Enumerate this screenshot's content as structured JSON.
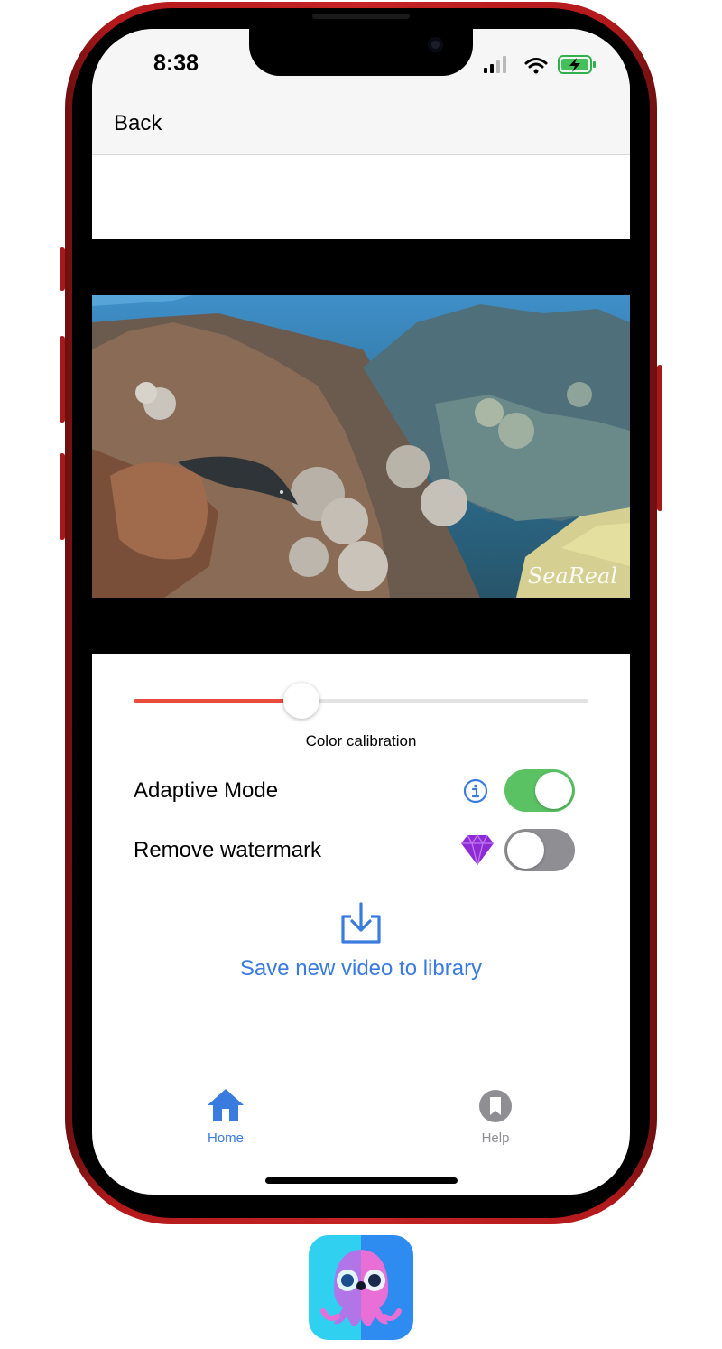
{
  "status_bar": {
    "time": "8:38"
  },
  "nav": {
    "back_label": "Back"
  },
  "video": {
    "watermark_text": "SeaReal"
  },
  "color_calibration": {
    "label": "Color calibration",
    "value": 0.37
  },
  "adaptive_mode": {
    "label": "Adaptive Mode",
    "enabled": true
  },
  "remove_watermark": {
    "label": "Remove watermark",
    "enabled": false
  },
  "save": {
    "label": "Save new video to library"
  },
  "tabs": [
    {
      "label": "Home",
      "active": true
    },
    {
      "label": "Help",
      "active": false
    }
  ],
  "colors": {
    "accent_blue": "#3a7be0",
    "slider_red": "#e74c3c",
    "toggle_on": "#5ac263",
    "toggle_off": "#8e8e93",
    "premium_purple": "#8e2bd6",
    "phone_red": "#c62324"
  },
  "icons": {
    "info": "info-circle-icon",
    "premium": "diamond-icon",
    "save": "download-tray-icon",
    "home": "house-icon",
    "help": "bookmark-circle-icon"
  }
}
